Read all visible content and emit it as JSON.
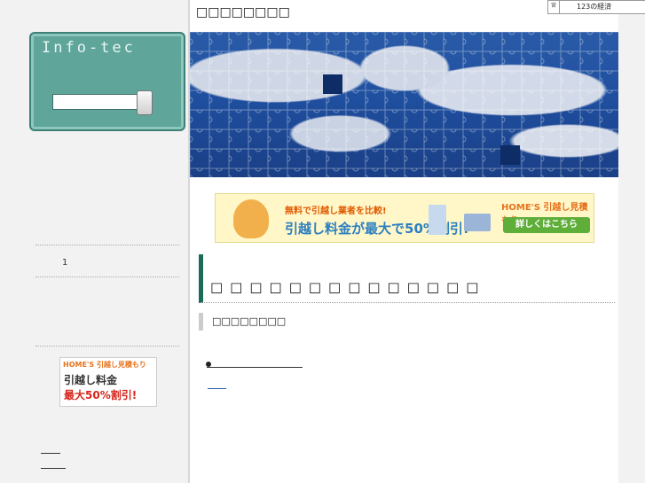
{
  "site": {
    "title": "□□□□□□□□"
  },
  "sidebar": {
    "logo_text": "Info-tec",
    "search": {
      "value": "",
      "placeholder": ""
    },
    "counter": "1",
    "banner": {
      "brand": "HOME'S 引越し見積もり",
      "line1": "引越し料金",
      "line2": "最大50%割引!"
    }
  },
  "main": {
    "ad_banner": {
      "sub": "無料で引越し業者を比較!",
      "main": "引越し料金が最大で50%割引!",
      "brand": "HOME'S 引越し見積もり",
      "cta": "詳しくはこちら"
    },
    "heading": "□□□□□□□□□□□□□□",
    "subheading": "□□□□□□□□"
  },
  "widget": {
    "left": "宮",
    "text": "123の経済"
  },
  "colors": {
    "accent": "#1c6b57",
    "logo_bg": "#5fa59a",
    "hero_blue": "#1f4f9f"
  }
}
